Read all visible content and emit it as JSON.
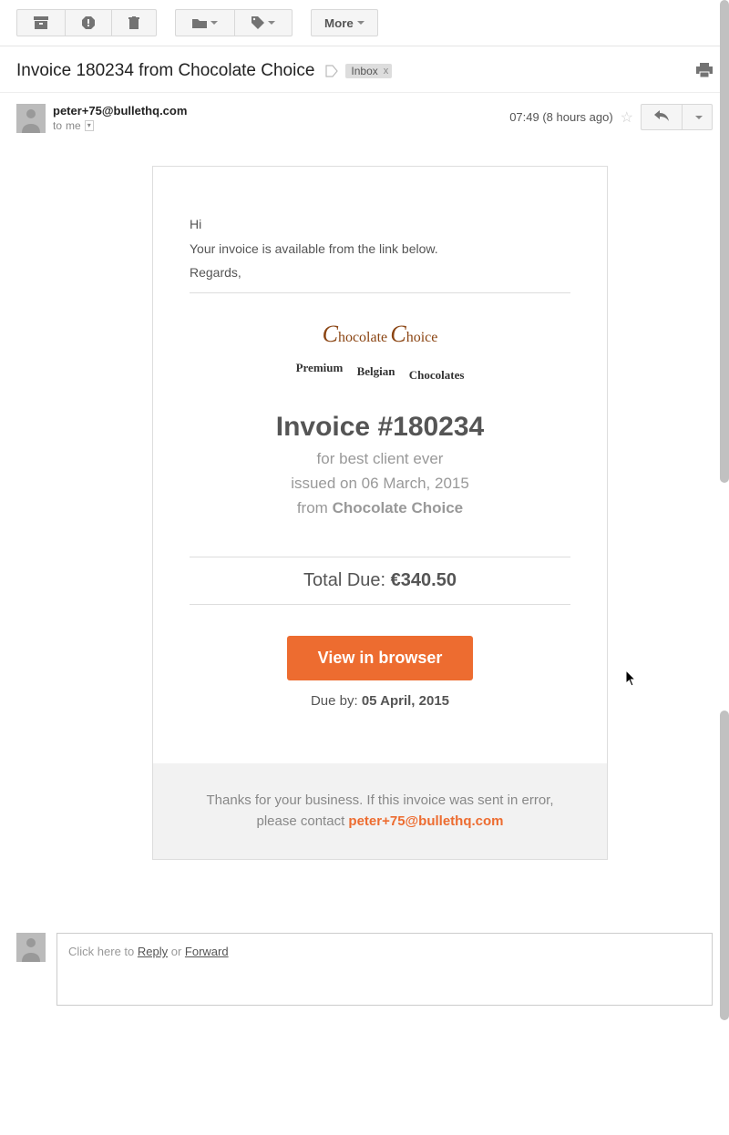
{
  "toolbar": {
    "more_label": "More"
  },
  "subject": "Invoice 180234 from Chocolate Choice",
  "label": {
    "name": "Inbox",
    "close": "x"
  },
  "email": {
    "from": "peter+75@bullethq.com",
    "to_prefix": "to",
    "to": "me",
    "time": "07:49 (8 hours ago)"
  },
  "body": {
    "greeting": "Hi",
    "intro": "Your invoice is available from the link below.",
    "signoff": "Regards,",
    "brand": {
      "word1_cap": "C",
      "word1_rest": "hocolate",
      "word2_cap": "C",
      "word2_rest": "hoice",
      "tag1": "Premium",
      "tag2": "Belgian",
      "tag3": "Chocolates"
    },
    "invoice_title": "Invoice #180234",
    "sub_for": "for best client ever",
    "sub_issued": "issued on 06 March, 2015",
    "sub_from_prefix": "from ",
    "sub_from_company": "Chocolate Choice",
    "total_label": "Total Due: ",
    "total_amount": "€340.50",
    "cta": "View in browser",
    "due_prefix": "Due by: ",
    "due_date": "05 April, 2015",
    "footer_text": "Thanks for your business. If this invoice was sent in error, please contact ",
    "footer_email": "peter+75@bullethq.com"
  },
  "reply": {
    "prefix": "Click here to ",
    "reply": "Reply",
    "or": " or ",
    "forward": "Forward"
  }
}
